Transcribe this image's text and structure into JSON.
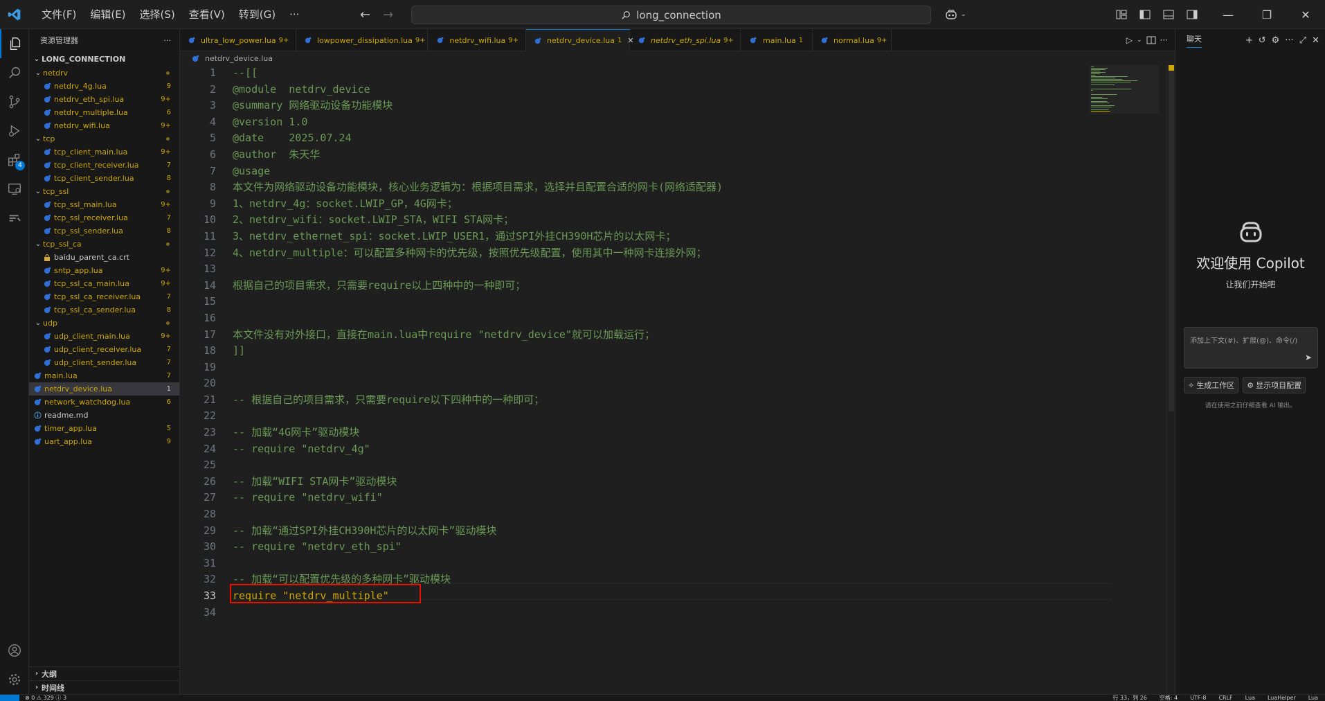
{
  "titlebar": {
    "menus": [
      "文件(F)",
      "编辑(E)",
      "选择(S)",
      "查看(V)",
      "转到(G)",
      "···"
    ],
    "search_text": "long_connection"
  },
  "activitybar": {
    "extensions_badge": "4"
  },
  "sidebar": {
    "title": "资源管理器",
    "more": "···",
    "root": "LONG_CONNECTION",
    "tree": [
      {
        "type": "folder",
        "label": "netdrv",
        "depth": 1,
        "count": ""
      },
      {
        "type": "file",
        "label": "netdrv_4g.lua",
        "depth": 2,
        "count": "9"
      },
      {
        "type": "file",
        "label": "netdrv_eth_spi.lua",
        "depth": 2,
        "count": "9+"
      },
      {
        "type": "file",
        "label": "netdrv_multiple.lua",
        "depth": 2,
        "count": "6"
      },
      {
        "type": "file",
        "label": "netdrv_wifi.lua",
        "depth": 2,
        "count": "9+"
      },
      {
        "type": "folder",
        "label": "tcp",
        "depth": 1,
        "count": ""
      },
      {
        "type": "file",
        "label": "tcp_client_main.lua",
        "depth": 2,
        "count": "9+"
      },
      {
        "type": "file",
        "label": "tcp_client_receiver.lua",
        "depth": 2,
        "count": "7"
      },
      {
        "type": "file",
        "label": "tcp_client_sender.lua",
        "depth": 2,
        "count": "8"
      },
      {
        "type": "folder",
        "label": "tcp_ssl",
        "depth": 1,
        "count": ""
      },
      {
        "type": "file",
        "label": "tcp_ssl_main.lua",
        "depth": 2,
        "count": "9+"
      },
      {
        "type": "file",
        "label": "tcp_ssl_receiver.lua",
        "depth": 2,
        "count": "7"
      },
      {
        "type": "file",
        "label": "tcp_ssl_sender.lua",
        "depth": 2,
        "count": "8"
      },
      {
        "type": "folder",
        "label": "tcp_ssl_ca",
        "depth": 1,
        "count": ""
      },
      {
        "type": "cert",
        "label": "baidu_parent_ca.crt",
        "depth": 2,
        "count": ""
      },
      {
        "type": "file",
        "label": "sntp_app.lua",
        "depth": 2,
        "count": "9+"
      },
      {
        "type": "file",
        "label": "tcp_ssl_ca_main.lua",
        "depth": 2,
        "count": "9+"
      },
      {
        "type": "file",
        "label": "tcp_ssl_ca_receiver.lua",
        "depth": 2,
        "count": "7"
      },
      {
        "type": "file",
        "label": "tcp_ssl_ca_sender.lua",
        "depth": 2,
        "count": "8"
      },
      {
        "type": "folder",
        "label": "udp",
        "depth": 1,
        "count": ""
      },
      {
        "type": "file",
        "label": "udp_client_main.lua",
        "depth": 2,
        "count": "9+"
      },
      {
        "type": "file",
        "label": "udp_client_receiver.lua",
        "depth": 2,
        "count": "7"
      },
      {
        "type": "file",
        "label": "udp_client_sender.lua",
        "depth": 2,
        "count": "7"
      },
      {
        "type": "file",
        "label": "main.lua",
        "depth": 1,
        "count": "7"
      },
      {
        "type": "file",
        "label": "netdrv_device.lua",
        "depth": 1,
        "count": "1",
        "selected": true
      },
      {
        "type": "file",
        "label": "network_watchdog.lua",
        "depth": 1,
        "count": "6"
      },
      {
        "type": "info",
        "label": "readme.md",
        "depth": 1,
        "count": ""
      },
      {
        "type": "file",
        "label": "timer_app.lua",
        "depth": 1,
        "count": "5"
      },
      {
        "type": "file",
        "label": "uart_app.lua",
        "depth": 1,
        "count": "9"
      }
    ],
    "outline_label": "大纲",
    "timeline_label": "时间线"
  },
  "tabs": [
    {
      "label": "ultra_low_power.lua",
      "count": "9+",
      "width": 168
    },
    {
      "label": "lowpower_dissipation.lua",
      "count": "9+",
      "width": 190
    },
    {
      "label": "netdrv_wifi.lua",
      "count": "9+",
      "width": 142
    },
    {
      "label": "netdrv_device.lua",
      "count": "1",
      "active": true,
      "width": 150
    },
    {
      "label": "netdrv_eth_spi.lua",
      "count": "9+",
      "italic": true,
      "width": 160
    },
    {
      "label": "main.lua",
      "count": "1",
      "width": 104
    },
    {
      "label": "normal.lua",
      "count": "9+",
      "width": 114
    }
  ],
  "breadcrumb": "netdrv_device.lua",
  "editor": {
    "lines": [
      {
        "n": "1",
        "text": "--[[",
        "kind": "comment"
      },
      {
        "n": "2",
        "text": "@module  netdrv_device",
        "kind": "comment"
      },
      {
        "n": "3",
        "text": "@summary 网络驱动设备功能模块",
        "kind": "comment"
      },
      {
        "n": "4",
        "text": "@version 1.0",
        "kind": "comment"
      },
      {
        "n": "5",
        "text": "@date    2025.07.24",
        "kind": "comment"
      },
      {
        "n": "6",
        "text": "@author  朱天华",
        "kind": "comment"
      },
      {
        "n": "7",
        "text": "@usage",
        "kind": "comment"
      },
      {
        "n": "8",
        "text": "本文件为网络驱动设备功能模块，核心业务逻辑为：根据项目需求，选择并且配置合适的网卡(网络适配器)",
        "kind": "comment"
      },
      {
        "n": "9",
        "text": "1、netdrv_4g：socket.LWIP_GP，4G网卡；",
        "kind": "comment"
      },
      {
        "n": "10",
        "text": "2、netdrv_wifi：socket.LWIP_STA，WIFI STA网卡；",
        "kind": "comment"
      },
      {
        "n": "11",
        "text": "3、netdrv_ethernet_spi：socket.LWIP_USER1，通过SPI外挂CH390H芯片的以太网卡；",
        "kind": "comment"
      },
      {
        "n": "12",
        "text": "4、netdrv_multiple：可以配置多种网卡的优先级，按照优先级配置，使用其中一种网卡连接外网；",
        "kind": "comment"
      },
      {
        "n": "13",
        "text": "",
        "kind": "comment"
      },
      {
        "n": "14",
        "text": "根据自己的项目需求，只需要require以上四种中的一种即可；",
        "kind": "comment"
      },
      {
        "n": "15",
        "text": "",
        "kind": "comment"
      },
      {
        "n": "16",
        "text": "",
        "kind": "comment"
      },
      {
        "n": "17",
        "text": "本文件没有对外接口，直接在main.lua中require \"netdrv_device\"就可以加载运行；",
        "kind": "comment"
      },
      {
        "n": "18",
        "text": "]]",
        "kind": "comment"
      },
      {
        "n": "19",
        "text": "",
        "kind": "comment"
      },
      {
        "n": "20",
        "text": "",
        "kind": "comment"
      },
      {
        "n": "21",
        "text": "-- 根据自己的项目需求，只需要require以下四种中的一种即可；",
        "kind": "comment"
      },
      {
        "n": "22",
        "text": "",
        "kind": "comment"
      },
      {
        "n": "23",
        "text": "-- 加载“4G网卡”驱动模块",
        "kind": "comment"
      },
      {
        "n": "24",
        "text": "-- require \"netdrv_4g\"",
        "kind": "comment"
      },
      {
        "n": "25",
        "text": "",
        "kind": "comment"
      },
      {
        "n": "26",
        "text": "-- 加载“WIFI STA网卡”驱动模块",
        "kind": "comment"
      },
      {
        "n": "27",
        "text": "-- require \"netdrv_wifi\"",
        "kind": "comment"
      },
      {
        "n": "28",
        "text": "",
        "kind": "comment"
      },
      {
        "n": "29",
        "text": "-- 加载“通过SPI外挂CH390H芯片的以太网卡”驱动模块",
        "kind": "comment"
      },
      {
        "n": "30",
        "text": "-- require \"netdrv_eth_spi\"",
        "kind": "comment"
      },
      {
        "n": "31",
        "text": "",
        "kind": "comment"
      },
      {
        "n": "32",
        "text": "-- 加载“可以配置优先级的多种网卡”驱动模块",
        "kind": "comment"
      },
      {
        "n": "33",
        "text": "require \"netdrv_multiple\"",
        "kind": "code",
        "current": true
      },
      {
        "n": "34",
        "text": "",
        "kind": "comment"
      }
    ]
  },
  "chat": {
    "tab_label": "聊天",
    "welcome_title": "欢迎使用 Copilot",
    "welcome_sub": "让我们开始吧",
    "input_placeholder": "添加上下文(#)、扩展(@)、命令(/)",
    "btn_workspace": "生成工作区",
    "btn_config": "显示项目配置",
    "disclaimer": "请在使用之前仔细查看 AI 输出。"
  },
  "statusbar": {
    "left": "⊗ 0 ⚠ 329 ⓘ 3",
    "right": [
      "行 33，列 26",
      "空格: 4",
      "UTF-8",
      "CRLF",
      "Lua",
      "LuaHelper",
      "Lua"
    ]
  },
  "colors": {
    "accent": "#0078d4",
    "modified": "#cca700",
    "comment": "#6a9955",
    "highlight_box": "#e51400"
  }
}
